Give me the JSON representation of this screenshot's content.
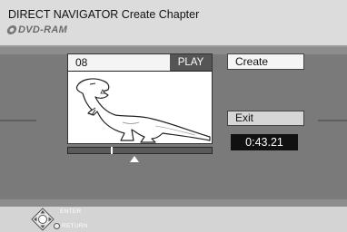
{
  "header": {
    "title": "DIRECT NAVIGATOR  Create Chapter",
    "subtitle": "DVD-RAM"
  },
  "preview": {
    "chapter_number": "08",
    "status_badge": "PLAY",
    "progress_fraction": 0.3
  },
  "buttons": {
    "create_label": "Create",
    "exit_label": "Exit"
  },
  "timecode": "0:43.21",
  "footer": {
    "enter_label": "ENTER",
    "return_label": "RETURN"
  }
}
